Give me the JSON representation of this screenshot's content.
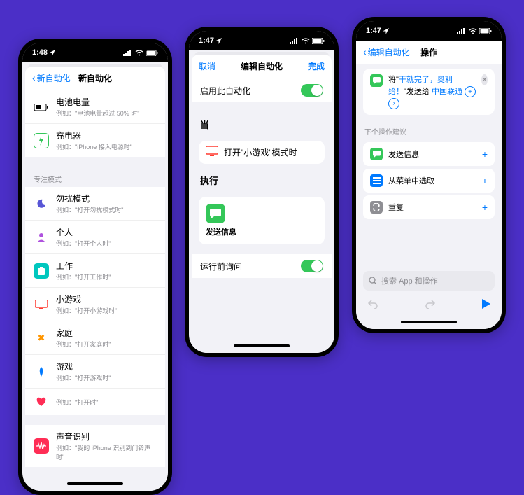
{
  "colors": {
    "bg": "#4b2fc7",
    "accent": "#007aff",
    "green": "#34c759"
  },
  "phone1": {
    "time": "1:48",
    "header": {
      "back": "新自动化",
      "title": "新自动化"
    },
    "settings_group": [
      {
        "icon": "battery",
        "title": "电池电量",
        "sub": "例如：\"电池电量超过 50% 时\""
      },
      {
        "icon": "charger",
        "title": "充电器",
        "sub": "例如：\"iPhone 接入电源时\""
      }
    ],
    "focus_label": "专注模式",
    "focus_group": [
      {
        "icon": "moon",
        "color": "#5856d6",
        "title": "勿扰模式",
        "sub": "例如：\"打开勿扰模式时\""
      },
      {
        "icon": "person",
        "color": "#af52de",
        "title": "个人",
        "sub": "例如：\"打开个人时\""
      },
      {
        "icon": "badge",
        "color": "#00c7be",
        "title": "工作",
        "sub": "例如：\"打开工作时\""
      },
      {
        "icon": "display",
        "color": "#ff3b30",
        "title": "小游戏",
        "sub": "例如：\"打开小游戏时\""
      },
      {
        "icon": "wrench",
        "color": "#ff9500",
        "title": "家庭",
        "sub": "例如：\"打开家庭时\""
      },
      {
        "icon": "rocket",
        "color": "#007aff",
        "title": "游戏",
        "sub": "例如：\"打开游戏时\""
      },
      {
        "icon": "heart",
        "color": "#ff2d55",
        "title": "",
        "sub": "例如：\"打开时\""
      }
    ],
    "sound_group": [
      {
        "icon": "wave",
        "color": "#ff2d55",
        "title": "声音识别",
        "sub": "例如：\"我的 iPhone 识别到门铃声时\""
      }
    ]
  },
  "phone2": {
    "time": "1:47",
    "header": {
      "left": "取消",
      "title": "编辑自动化",
      "right": "完成"
    },
    "enable_row": {
      "label": "启用此自动化"
    },
    "when_heading": "当",
    "when_card": {
      "label": "打开\"小游戏\"模式时"
    },
    "do_heading": "执行",
    "action": {
      "label": "发送信息"
    },
    "ask_row": {
      "label": "运行前询问"
    }
  },
  "phone3": {
    "time": "1:47",
    "header": {
      "back": "编辑自动化",
      "title": "操作"
    },
    "msg_card": {
      "prefix": "将\"",
      "body": "干就完了，奥利给！",
      "suffix": "\"发送给",
      "recipient": "中国联通"
    },
    "suggest_label": "下个操作建议",
    "suggestions": [
      {
        "icon": "msg",
        "color": "#34c759",
        "label": "发送信息"
      },
      {
        "icon": "list",
        "color": "#007aff",
        "label": "从菜单中选取"
      },
      {
        "icon": "repeat",
        "color": "#8e8e93",
        "label": "重复"
      }
    ],
    "search_placeholder": "搜索 App 和操作"
  }
}
